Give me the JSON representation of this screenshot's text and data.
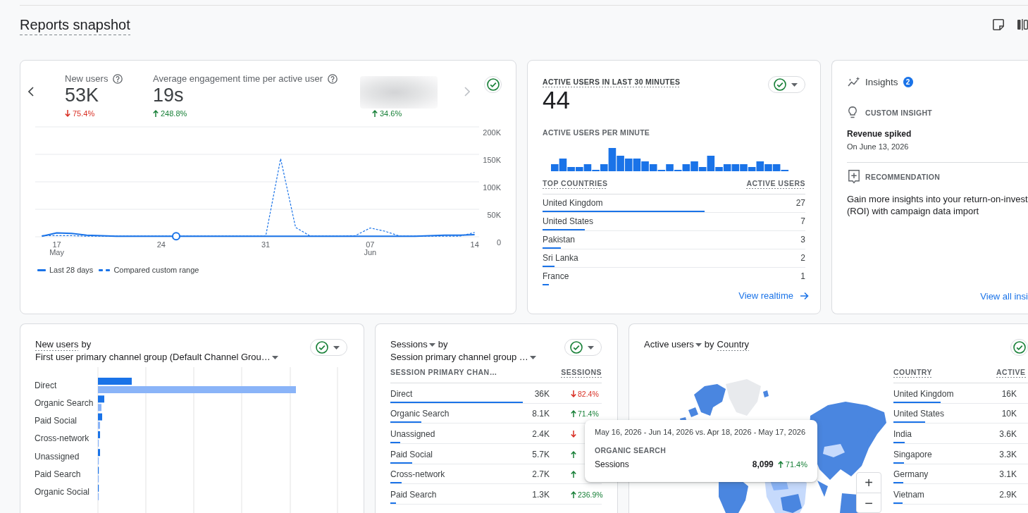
{
  "page": {
    "title": "Reports snapshot"
  },
  "overview": {
    "next_disabled": true,
    "metrics": [
      {
        "kind": "metric",
        "label": "New users",
        "value": "53K",
        "change": "75.4%",
        "increase": false
      },
      {
        "kind": "metric",
        "label": "Average engagement time per active user",
        "value": "19s",
        "change": "248.8%",
        "increase": true
      },
      {
        "kind": "blurred",
        "change": "34.6%",
        "increase": true
      }
    ],
    "chart_data": {
      "type": "line",
      "grid": true,
      "categories": [
        null,
        "17\nMay",
        null,
        null,
        null,
        null,
        null,
        null,
        "24",
        null,
        null,
        null,
        null,
        null,
        null,
        "31",
        null,
        null,
        null,
        null,
        null,
        null,
        "07\nJun",
        null,
        null,
        null,
        null,
        null,
        null,
        "14"
      ],
      "ylim": [
        0,
        200000
      ],
      "yticks": [
        {
          "value": 0,
          "label": "0"
        },
        {
          "value": 50000,
          "label": "50K"
        },
        {
          "value": 100000,
          "label": "100K"
        },
        {
          "value": 150000,
          "label": "150K"
        },
        {
          "value": 200000,
          "label": "200K"
        }
      ],
      "series": [
        {
          "name": "Last 28 days",
          "color": "#1a73e8",
          "line_style": "solid",
          "values": [
            1000,
            7000,
            6000,
            3000,
            2000,
            1000,
            1000,
            1000,
            1000,
            1000,
            1000,
            1000,
            1000,
            1000,
            1000,
            1000,
            1000,
            1000,
            1000,
            1000,
            1000,
            1000,
            1000,
            1000,
            1000,
            1000,
            2000,
            3000,
            3000,
            4000
          ]
        },
        {
          "name": "Compared custom range",
          "color": "#1a73e8",
          "line_style": "dashed",
          "values": [
            2000,
            2000,
            2000,
            1000,
            1000,
            1000,
            1000,
            1000,
            1000,
            1000,
            1000,
            1000,
            1000,
            1000,
            1000,
            1000,
            142000,
            17000,
            1000,
            1000,
            1000,
            2000,
            16000,
            10000,
            1000,
            1000,
            1000,
            1000,
            1000,
            8000
          ]
        }
      ]
    }
  },
  "realtime": {
    "title": "ACTIVE USERS IN LAST 30 MINUTES",
    "value": "44",
    "subtitle": "ACTIVE USERS PER MINUTE",
    "columns": [
      {
        "label": "TOP COUNTRIES",
        "underlined": true
      },
      {
        "label": "ACTIVE USERS",
        "underlined": true
      }
    ],
    "rows": [
      {
        "name": "United Kingdom",
        "value": "27",
        "level": 0.616
      },
      {
        "name": "United States",
        "value": "7",
        "level": 0.16
      },
      {
        "name": "Pakistan",
        "value": "3",
        "level": 0.069
      },
      {
        "name": "Sri Lanka",
        "value": "2",
        "level": 0.046
      },
      {
        "name": "France",
        "value": "1",
        "level": 0.024
      }
    ],
    "link": "View realtime"
  },
  "insights": {
    "title": "Insights",
    "badge": "2",
    "items": [
      {
        "kind": "insight",
        "label": "CUSTOM INSIGHT",
        "title": "Revenue spiked",
        "date": "On June 13, 2026"
      },
      {
        "kind": "recommendation",
        "label": "RECOMMENDATION",
        "text": "Gain more insights into your return-on-invest\n(ROI) with campaign data import"
      }
    ],
    "link": "View all insi"
  },
  "new_users": {
    "metric": "New users",
    "joiner": "by",
    "dimension": "First user primary channel group (Default Channel Grou…",
    "categories": [
      "Direct",
      "Organic Search",
      "Paid Social",
      "Cross-network",
      "Unassigned",
      "Paid Search",
      "Organic Social"
    ]
  },
  "sessions": {
    "metric": "Sessions",
    "joiner": "by",
    "dimension": "Session primary channel group …",
    "columns": [
      {
        "label": "SESSION PRIMARY CHAN…",
        "underlined": false
      },
      {
        "label": "SESSIONS",
        "underlined": true
      }
    ],
    "rows": [
      {
        "name": "Direct",
        "value": "36K",
        "change": "82.4%",
        "increase": false,
        "level": 0.627
      },
      {
        "name": "Organic Search",
        "value": "8.1K",
        "change": "71.4%",
        "increase": true,
        "level": 0.145
      },
      {
        "name": "Unassigned",
        "value": "2.4K",
        "increase": false,
        "level": 0.046
      },
      {
        "name": "Paid Social",
        "value": "5.7K",
        "increase": true,
        "level": 0.103
      },
      {
        "name": "Cross-network",
        "value": "2.7K",
        "increase": true,
        "level": 0.052
      },
      {
        "name": "Paid Search",
        "value": "1.3K",
        "change": "236.9%",
        "increase": true,
        "level": 0.026
      }
    ]
  },
  "countries": {
    "metric": "Active users",
    "joiner": "by",
    "dimension": "Country",
    "columns": [
      {
        "label": "COUNTRY",
        "underlined": true
      },
      {
        "label": "ACTIVE",
        "underlined": true
      }
    ],
    "rows": [
      {
        "name": "United Kingdom",
        "value": "16K",
        "level": 0.35
      },
      {
        "name": "United States",
        "value": "10K",
        "level": 0.236
      },
      {
        "name": "India",
        "value": "3.6K",
        "level": 0.084
      },
      {
        "name": "Singapore",
        "value": "3.3K",
        "level": 0.079
      },
      {
        "name": "Germany",
        "value": "3.1K",
        "level": 0.072
      },
      {
        "name": "Vietnam",
        "value": "2.9K",
        "level": 0.068
      }
    ],
    "zoom": {
      "in": "+",
      "out": "−"
    }
  },
  "tooltip": {
    "range": "May 16, 2026 - Jun 14, 2026 vs. Apr 18, 2026 - May 17, 2026",
    "label": "ORGANIC SEARCH",
    "metric": "Sessions",
    "value": "8,099",
    "change": "71.4%",
    "increase": true
  }
}
